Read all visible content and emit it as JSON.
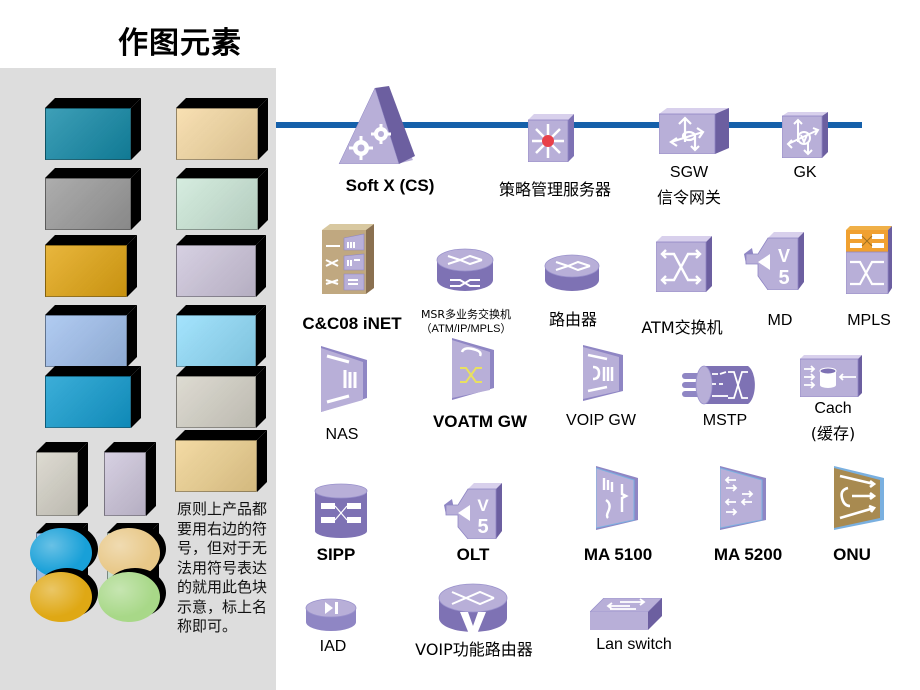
{
  "title": "作图元素",
  "legend_panel": {
    "note": "原则上产品都要用右边的符号，但对于无法用符号表达的就用此色块示意，标上名称即可。",
    "color_blocks": [
      {
        "shape": "box",
        "color": "#138aa8"
      },
      {
        "shape": "box",
        "color": "#f6d9a2"
      },
      {
        "shape": "box",
        "color": "#9b9b9b"
      },
      {
        "shape": "box",
        "color": "#cce8d8"
      },
      {
        "shape": "box",
        "color": "#e3a612"
      },
      {
        "shape": "box",
        "color": "#cec6dc"
      },
      {
        "shape": "box",
        "color": "#a0c0ee"
      },
      {
        "shape": "box",
        "color": "#90ddfc"
      },
      {
        "shape": "box",
        "color": "#119cd0"
      },
      {
        "shape": "box",
        "color": "#d6d3c8"
      },
      {
        "shape": "box",
        "color": "#f0d290"
      },
      {
        "shape": "tall-box",
        "color": "#d6d3c8"
      },
      {
        "shape": "tall-box",
        "color": "#cec6dc"
      },
      {
        "shape": "tall-box",
        "color": "#a0c0ee"
      },
      {
        "shape": "tall-box",
        "color": "#cce8d8"
      },
      {
        "shape": "disc",
        "color": "#18a0d8"
      },
      {
        "shape": "disc",
        "color": "#e8c888"
      },
      {
        "shape": "disc",
        "color": "#dfa814"
      },
      {
        "shape": "disc",
        "color": "#a8d888"
      }
    ]
  },
  "colors": {
    "bus_line": "#1560aa",
    "device_purple": "#b8afd8",
    "device_purple_dark": "#6c5fa0",
    "device_gold": "#b0884a",
    "panel_bg": "#dddddd"
  },
  "devices": {
    "softx": {
      "label": "Soft X (CS)",
      "icon": "softswitch-gear-icon"
    },
    "policy": {
      "label": "策略管理服务器",
      "icon": "policy-server-icon"
    },
    "sgw": {
      "label_line1": "SGW",
      "label_line2": "信令网关",
      "icon": "signaling-gateway-icon"
    },
    "gk": {
      "label": "GK",
      "icon": "gatekeeper-icon"
    },
    "cc08": {
      "label": "C&C08 iNET",
      "icon": "cc08-switch-icon"
    },
    "msr": {
      "label_line1": "MSR多业务交换机",
      "label_line2": "（ATM/IP/MPLS）",
      "icon": "msr-router-icon"
    },
    "router": {
      "label": "路由器",
      "icon": "router-icon"
    },
    "atm": {
      "label": "ATM交换机",
      "icon": "atm-switch-icon"
    },
    "md": {
      "label": "MD",
      "icon": "v5-md-icon"
    },
    "mpls": {
      "label": "MPLS",
      "icon": "mpls-switch-icon"
    },
    "nas": {
      "label": "NAS",
      "icon": "nas-icon"
    },
    "voatm": {
      "label": "VOATM GW",
      "icon": "voatm-gateway-icon"
    },
    "voip_gw": {
      "label": "VOIP GW",
      "icon": "voip-gateway-icon"
    },
    "mstp": {
      "label": "MSTP",
      "icon": "mstp-icon"
    },
    "cache": {
      "label_line1": "Cach",
      "label_line2": "(缓存)",
      "icon": "cache-icon"
    },
    "sipp": {
      "label": "SIPP",
      "icon": "sipp-database-icon"
    },
    "olt": {
      "label": "OLT",
      "icon": "v5-olt-icon"
    },
    "ma5100": {
      "label": "MA 5100",
      "icon": "ma5100-icon"
    },
    "ma5200": {
      "label": "MA 5200",
      "icon": "ma5200-icon"
    },
    "onu": {
      "label": "ONU",
      "icon": "onu-icon"
    },
    "iad": {
      "label": "IAD",
      "icon": "iad-icon"
    },
    "voip_router": {
      "label": "VOIP功能路由器",
      "icon": "voip-router-icon"
    },
    "lan_switch": {
      "label": "Lan switch",
      "icon": "lan-switch-icon"
    }
  }
}
